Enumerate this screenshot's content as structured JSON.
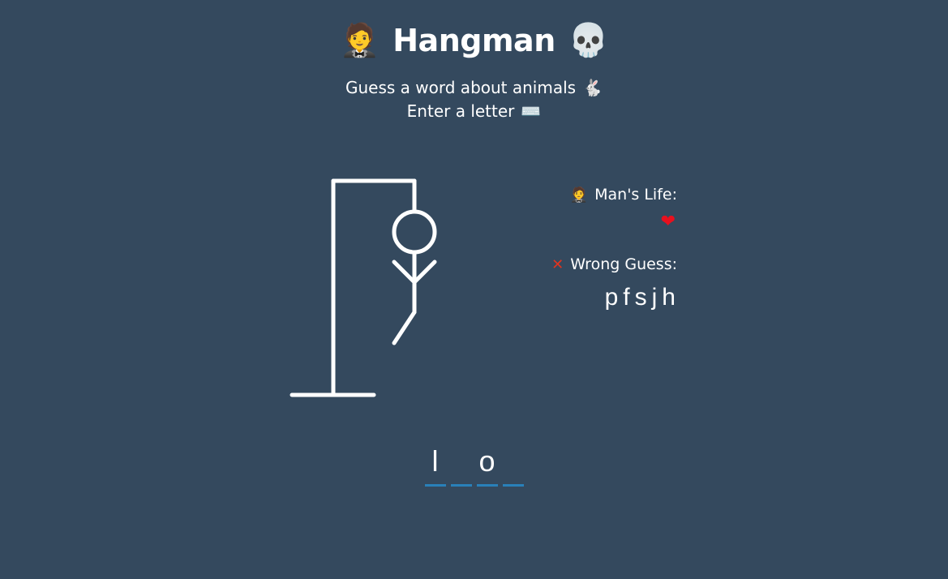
{
  "header": {
    "title": "Hangman",
    "title_icon_left": "🤵",
    "title_icon_right": "💀",
    "hint_line": "Guess a word about animals",
    "hint_icon": "🐇",
    "instruction_line": "Enter a letter",
    "instruction_icon": "⌨️"
  },
  "status": {
    "life_label": "Man's Life:",
    "life_icon": "🤵",
    "lives_remaining": "❤",
    "wrong_label": "Wrong Guess:",
    "wrong_icon": "✕",
    "wrong_letters": "pfsjh"
  },
  "word": {
    "slots": [
      "l",
      "",
      "o",
      ""
    ]
  },
  "colors": {
    "background": "#34495e",
    "underline": "#2980b9",
    "heart": "#e8101e"
  }
}
